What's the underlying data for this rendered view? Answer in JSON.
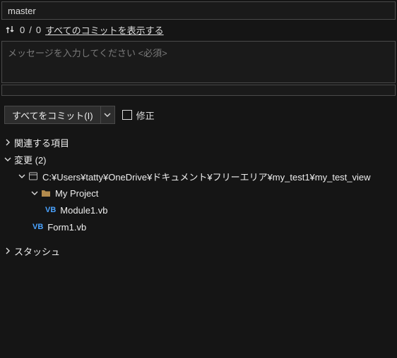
{
  "branch": "master",
  "counts": {
    "up": 0,
    "down": 0
  },
  "links": {
    "showAllCommits": "すべてのコミットを表示する"
  },
  "commitMessage": {
    "placeholder": "メッセージを入力してください <必須>"
  },
  "buttons": {
    "commitAll": "すべてをコミット(I)"
  },
  "checkboxes": {
    "amend": "修正"
  },
  "sections": {
    "related": "関連する項目",
    "changes": "変更 (2)",
    "stash": "スタッシュ"
  },
  "tree": {
    "repoPath": "C:¥Users¥tatty¥OneDrive¥ドキュメント¥フリーエリア¥my_test1¥my_test_view",
    "project": "My Project",
    "files": {
      "module": "Module1.vb",
      "form": "Form1.vb"
    }
  }
}
